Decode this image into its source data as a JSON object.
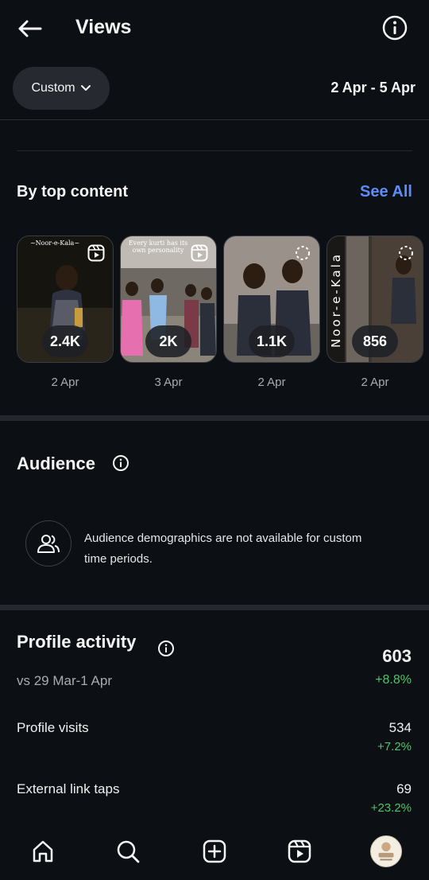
{
  "header": {
    "title": "Views"
  },
  "filter": {
    "range_label": "Custom",
    "date_range": "2 Apr - 5 Apr"
  },
  "top_content": {
    "title": "By top content",
    "see_all": "See All",
    "items": [
      {
        "views": "2.4K",
        "date": "2 Apr",
        "caption": "~Noor-e-Kala~"
      },
      {
        "views": "2K",
        "date": "3 Apr",
        "caption": "Every kurti has its own personality"
      },
      {
        "views": "1.1K",
        "date": "2 Apr",
        "caption": ""
      },
      {
        "views": "856",
        "date": "2 Apr",
        "caption": "Noor-e-Kala"
      }
    ]
  },
  "audience": {
    "title": "Audience",
    "message": "Audience demographics are not available for custom time periods."
  },
  "profile_activity": {
    "title": "Profile activity",
    "total": "603",
    "total_delta": "+8.8%",
    "comparison": "vs 29 Mar-1 Apr",
    "rows": [
      {
        "label": "Profile visits",
        "value": "534",
        "delta": "+7.2%"
      },
      {
        "label": "External link taps",
        "value": "69",
        "delta": "+23.2%"
      }
    ]
  },
  "colors": {
    "background": "#0c1014",
    "accent": "#5b8ef9",
    "positive": "#4fc46a",
    "chip": "#262a30"
  },
  "icons": [
    "back-arrow-icon",
    "info-icon",
    "chevron-down-icon",
    "reel-icon",
    "people-icon",
    "home-icon",
    "search-icon",
    "create-icon",
    "reels-icon"
  ]
}
